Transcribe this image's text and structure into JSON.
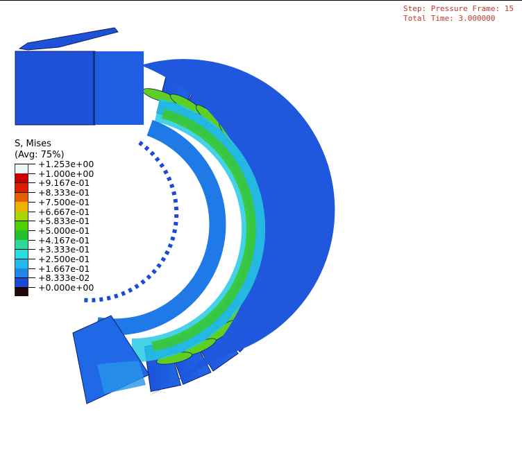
{
  "step_info": {
    "line1": "Step: Pressure Frame: 15",
    "line2": "Total Time: 3.000000"
  },
  "legend": {
    "title_line1": "S, Mises",
    "title_line2": "(Avg: 75%)",
    "labels": [
      "+1.253e+00",
      "+1.000e+00",
      "+9.167e-01",
      "+8.333e-01",
      "+7.500e-01",
      "+6.667e-01",
      "+5.833e-01",
      "+5.000e-01",
      "+4.167e-01",
      "+3.333e-01",
      "+2.500e-01",
      "+1.667e-01",
      "+8.333e-02",
      "+0.000e+00"
    ],
    "colors": [
      "#eaf6f6",
      "#cc0000",
      "#dd1f00",
      "#e85d00",
      "#eeb100",
      "#a8d400",
      "#4ed000",
      "#24c02e",
      "#2fd99a",
      "#27dfe0",
      "#21b9ee",
      "#1f86ea",
      "#1a4bd8",
      "#220808"
    ]
  },
  "colors": {
    "body_blue": "#1e50d8",
    "mid_blue": "#1f7ae8",
    "cyan": "#26c9e4",
    "green": "#38c832",
    "lime": "#6fd215",
    "title_red": "#c0392b"
  }
}
